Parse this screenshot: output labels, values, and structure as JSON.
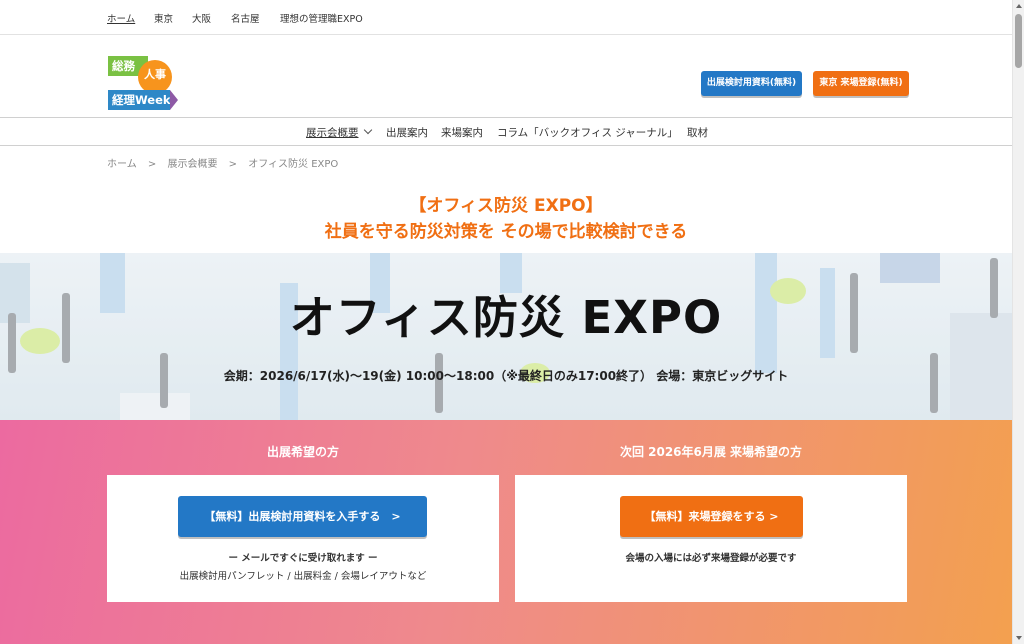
{
  "topbar": {
    "links": [
      "ホーム",
      "東京",
      "大阪",
      "名古屋",
      "理想の管理職EXPO"
    ]
  },
  "logo": {
    "line1": "総務",
    "line2": "人事",
    "line3": "経理Week"
  },
  "header": {
    "materials_button": "出展検討用資料(無料)",
    "register_button": "東京 来場登録(無料)"
  },
  "nav": {
    "items": [
      "展示会概要",
      "出展案内",
      "来場案内",
      "コラム「バックオフィス ジャーナル」",
      "取材"
    ]
  },
  "breadcrumb": {
    "items": [
      "ホーム",
      ">",
      "展示会概要",
      ">",
      "オフィス防災 EXPO"
    ]
  },
  "headline": {
    "line1": "【オフィス防災 EXPO】",
    "line2": "社員を守る防災対策を その場で比較検討できる"
  },
  "hero": {
    "title": "オフィス防災 EXPO",
    "subtitle": "会期：2026/6/17(水)〜19(金) 10:00〜18:00（※最終日のみ17:00終了） 会場：東京ビッグサイト"
  },
  "cta": {
    "left_heading": "出展希望の方",
    "left_button": "【無料】出展検討用資料を入手する　>",
    "left_note1": "ー メールですぐに受け取れます ー",
    "left_note2": "出展検討用パンフレット / 出展料金 / 会場レイアウトなど",
    "right_heading": "次回 2026年6月展 来場希望の方",
    "right_button": "【無料】来場登録をする >",
    "right_note": "会場の入場には必ず来場登録が必要です"
  },
  "colors": {
    "accent_orange": "#f06f13",
    "accent_blue": "#2378c6"
  }
}
